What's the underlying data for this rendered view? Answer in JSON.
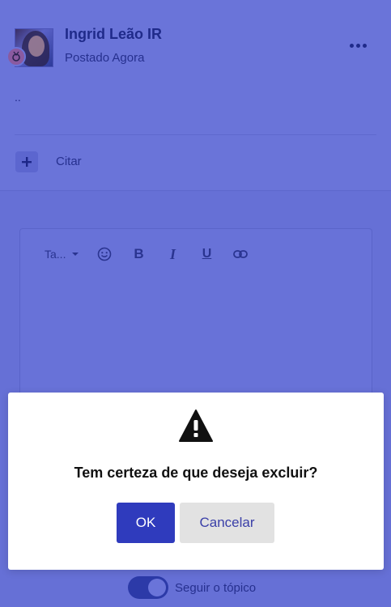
{
  "post": {
    "author": "Ingrid Leão IR",
    "time": "Postado Agora",
    "body": "..",
    "add_icon": "plus-icon",
    "cite_label": "Citar",
    "more_icon": "more-horizontal-icon"
  },
  "editor": {
    "font_size_label": "Ta...",
    "tools": [
      "emoji-icon",
      "bold-icon",
      "italic-icon",
      "underline-icon",
      "link-icon"
    ],
    "bold": "B",
    "italic": "I",
    "underline": "U"
  },
  "follow": {
    "label": "Seguir o tópico",
    "enabled": true
  },
  "dialog": {
    "icon": "warning-icon",
    "message": "Tem certeza de que deseja excluir?",
    "ok_label": "OK",
    "cancel_label": "Cancelar"
  },
  "colors": {
    "overlay": "#6670d6",
    "primary": "#2f3bbd",
    "cancel_bg": "#e2e2e2"
  }
}
